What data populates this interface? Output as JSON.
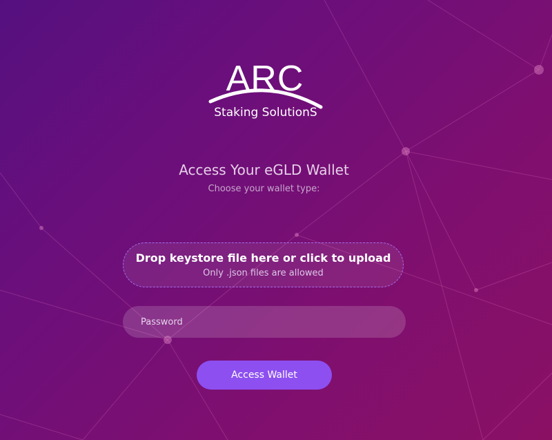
{
  "logo": {
    "main": "ARC",
    "sub": "Staking SolutionS"
  },
  "heading": {
    "title": "Access Your eGLD Wallet",
    "subtitle": "Choose your wallet type:"
  },
  "upload": {
    "title": "Drop keystore file here or click to upload",
    "hint": "Only .json files are allowed"
  },
  "password": {
    "placeholder": "Password",
    "value": ""
  },
  "submit": {
    "label": "Access Wallet"
  },
  "colors": {
    "background_start": "#55107f",
    "background_end": "#8a1064",
    "accent": "#8d4ff0",
    "dashed_border": "#a56ff0"
  }
}
